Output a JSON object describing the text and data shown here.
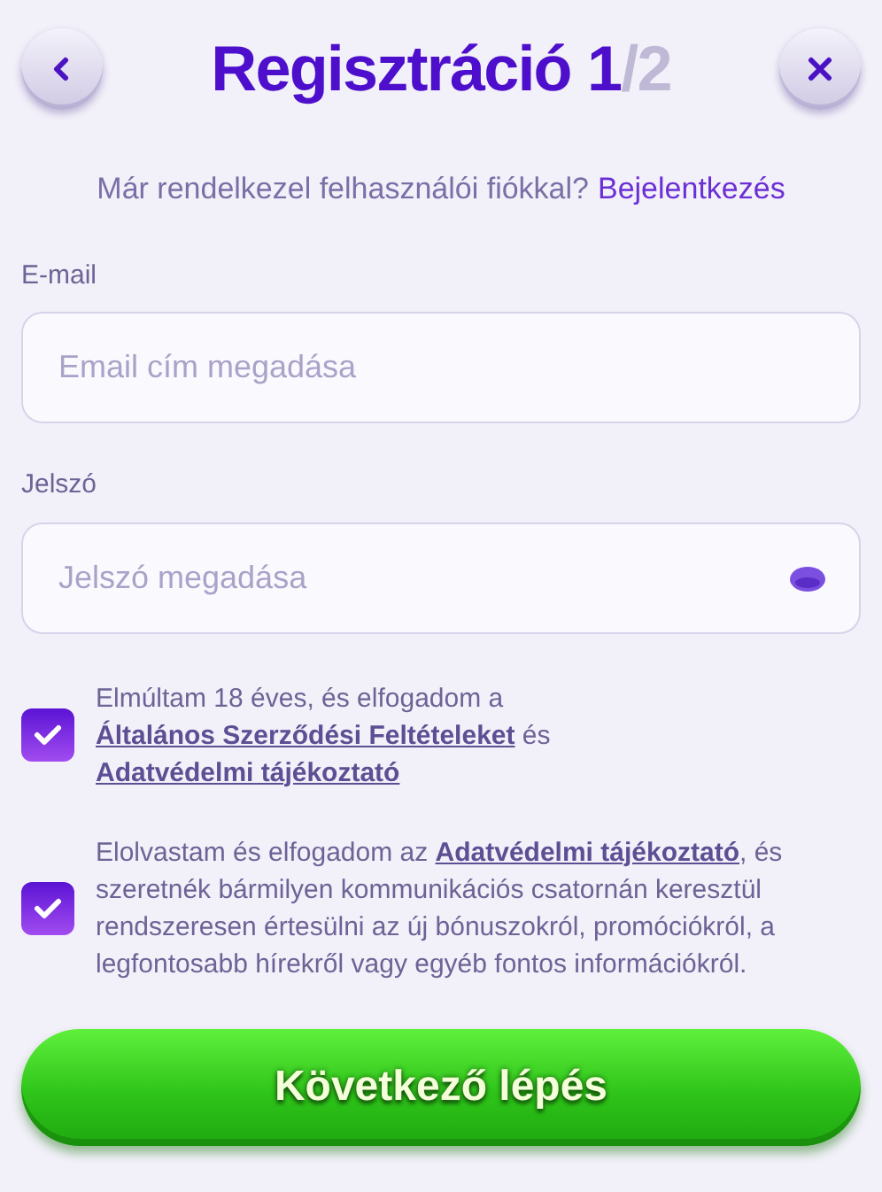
{
  "header": {
    "title": "Regisztráció 1",
    "step_total": "/2"
  },
  "login_prompt": {
    "text": "Már rendelkezel felhasználói fiókkal?",
    "link": "Bejelentkezés"
  },
  "fields": [
    {
      "label": "E-mail",
      "placeholder": "Email cím megadása",
      "kind": "text"
    },
    {
      "label": "Jelszó",
      "placeholder": "Jelszó megadása",
      "kind": "password"
    }
  ],
  "consents": [
    {
      "checked": true,
      "segments": [
        {
          "kind": "plain",
          "text": "Elmúltam 18 éves, és elfogadom a"
        },
        {
          "kind": "link",
          "text": "Általános Szerződési Feltételeket"
        },
        {
          "kind": "plain",
          "text": "és"
        },
        {
          "kind": "link",
          "text": "Adatvédelmi tájékoztató"
        }
      ]
    },
    {
      "checked": true,
      "segments": [
        {
          "kind": "plain",
          "text": "Elolvastam és elfogadom az"
        },
        {
          "kind": "link",
          "text": "Adatvédelmi tájékoztató"
        },
        {
          "kind": "plain",
          "text": ", és szeretnék bármilyen kommunikációs csatornán keresztül rendszeresen értesülni az új bónuszokról, promóciókról, a legfontosabb hírekről vagy egyéb fontos információkról."
        }
      ]
    }
  ],
  "submit": "Következő lépés"
}
